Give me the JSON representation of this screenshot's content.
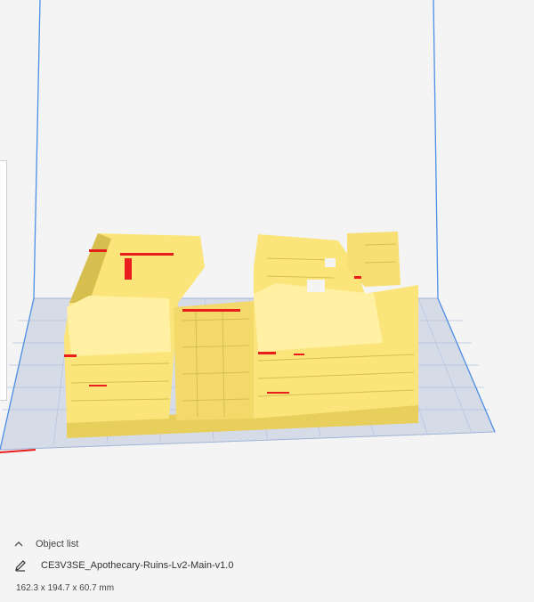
{
  "object_panel": {
    "object_list_label": "Object list",
    "object_name": "CE3V3SE_Apothecary-Ruins-Lv2-Main-v1.0",
    "dimensions": "162.3 x 194.7 x 60.7 mm"
  },
  "colors": {
    "background": "#f4f4f4",
    "build_volume_edge": "#4f8fe6",
    "build_plate": "#d6dbe8",
    "grid_line": "#9fb4d6",
    "model_yellow": "#fbe57a",
    "model_shadow": "#d6bf4f",
    "overhang_red": "#e81d1d"
  },
  "icons": {
    "object_list_toggle": "chevron-up-icon",
    "object_name_edit": "pencil-icon"
  }
}
